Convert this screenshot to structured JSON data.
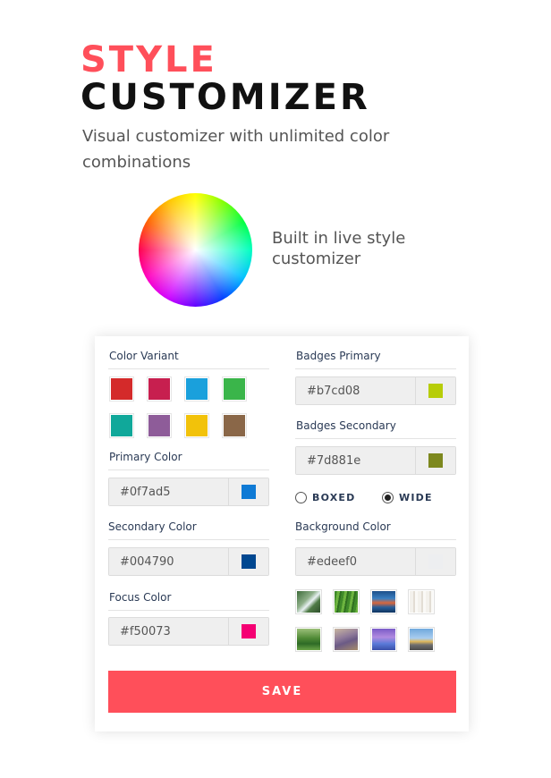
{
  "header": {
    "title_accent": "STYLE",
    "title_main": "CUSTOMIZER",
    "subtitle": "Visual customizer with unlimited color combinations",
    "accent_color": "#ff4f5a"
  },
  "feature": {
    "icon": "color-wheel-icon",
    "text": "Built in live style customizer"
  },
  "panel": {
    "color_variant": {
      "label": "Color Variant",
      "swatches": [
        "#d42a2a",
        "#c71f4f",
        "#1aa0dc",
        "#3ab54a",
        "#10a89a",
        "#8e5c99",
        "#f2c20a",
        "#8a6748"
      ]
    },
    "primary": {
      "label": "Primary Color",
      "value": "#0f7ad5"
    },
    "secondary": {
      "label": "Secondary Color",
      "value": "#004790"
    },
    "focus": {
      "label": "Focus Color",
      "value": "#f50073"
    },
    "badges_primary": {
      "label": "Badges Primary",
      "value": "#b7cd08"
    },
    "badges_secondary": {
      "label": "Badges Secondary",
      "value": "#7d881e"
    },
    "layout": {
      "options": [
        "BOXED",
        "WIDE"
      ],
      "selected": "WIDE"
    },
    "background": {
      "label": "Background Color",
      "value": "#edeef0",
      "thumbnails": [
        "waterfall-forest",
        "green-grass",
        "coastal-town",
        "white-curtains",
        "green-park",
        "lavender-field",
        "purple-landscape",
        "open-road"
      ]
    },
    "save_label": "SAVE"
  }
}
